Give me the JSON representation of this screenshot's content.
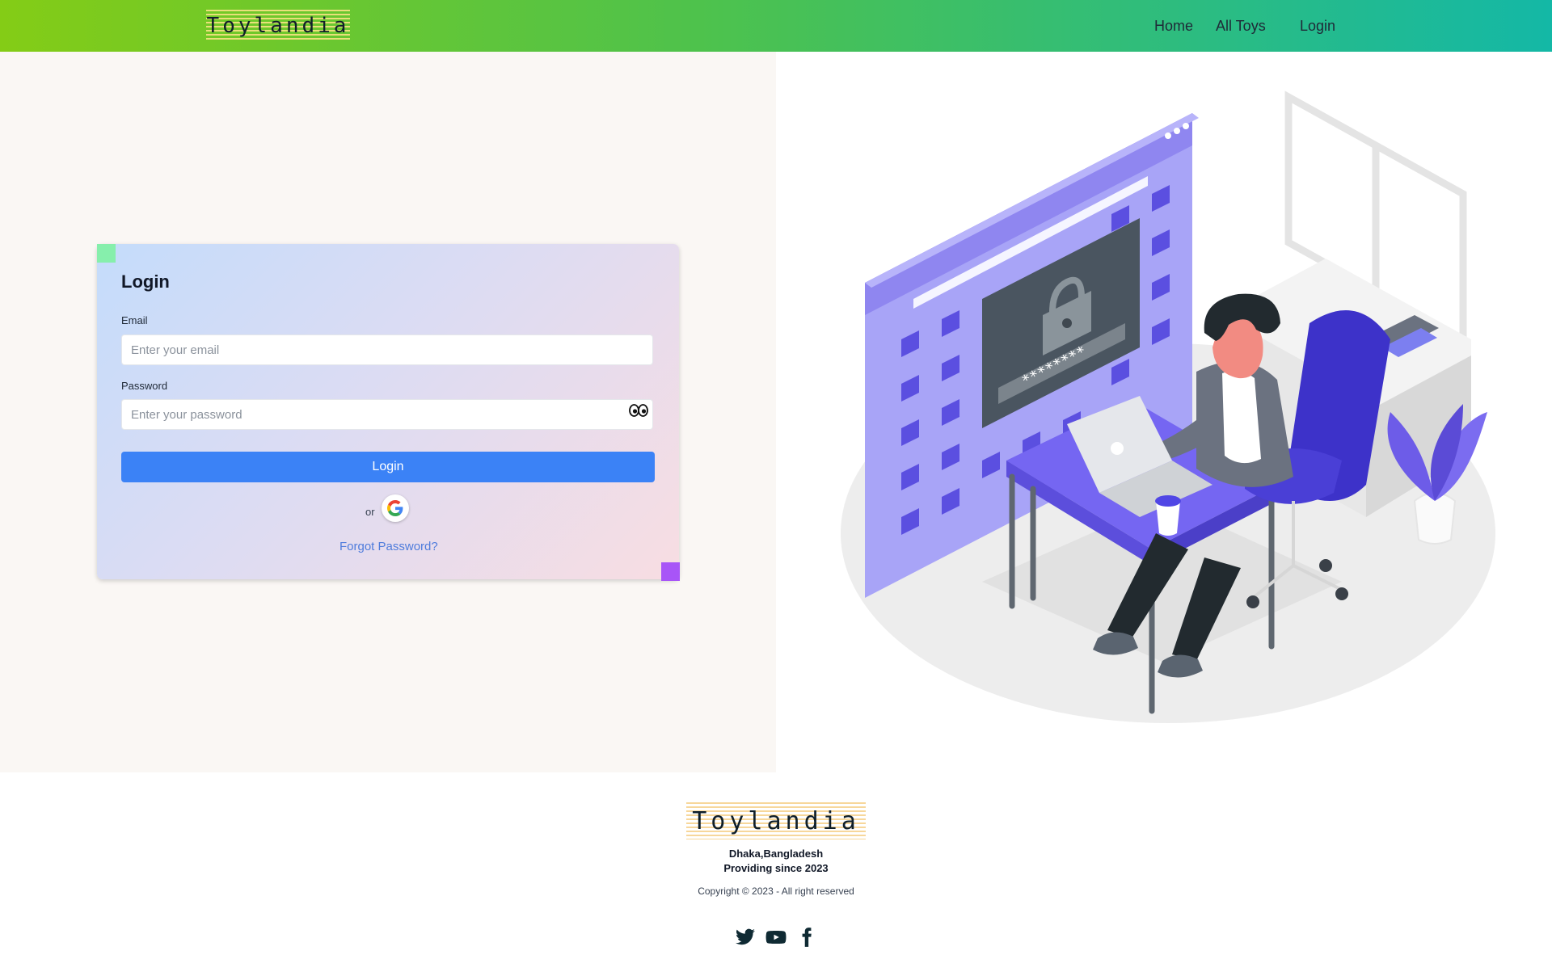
{
  "navbar": {
    "logo_text": "Toylandia",
    "links": [
      {
        "label": "Home"
      },
      {
        "label": "All Toys"
      },
      {
        "label": "Login"
      }
    ]
  },
  "login_form": {
    "title": "Login",
    "email": {
      "label": "Email",
      "placeholder": "Enter your email",
      "value": ""
    },
    "password": {
      "label": "Password",
      "placeholder": "Enter your password",
      "value": ""
    },
    "submit_label": "Login",
    "or_text": "or",
    "google_icon": "google-icon",
    "forgot_label": "Forgot Password?",
    "colors": {
      "button": "#3b82f6",
      "corner_tl": "#86efac",
      "corner_br": "#a855f7",
      "link": "#4f7cdc"
    }
  },
  "illustration": {
    "subject": "person-at-laptop-login-illustration",
    "password_mask": "********"
  },
  "footer": {
    "logo_text": "Toylandia",
    "address": "Dhaka,Bangladesh",
    "since": "Providing since 2023",
    "copyright": "Copyright © 2023 - All right reserved",
    "social": [
      {
        "icon": "twitter-icon"
      },
      {
        "icon": "youtube-icon"
      },
      {
        "icon": "facebook-icon"
      }
    ]
  }
}
